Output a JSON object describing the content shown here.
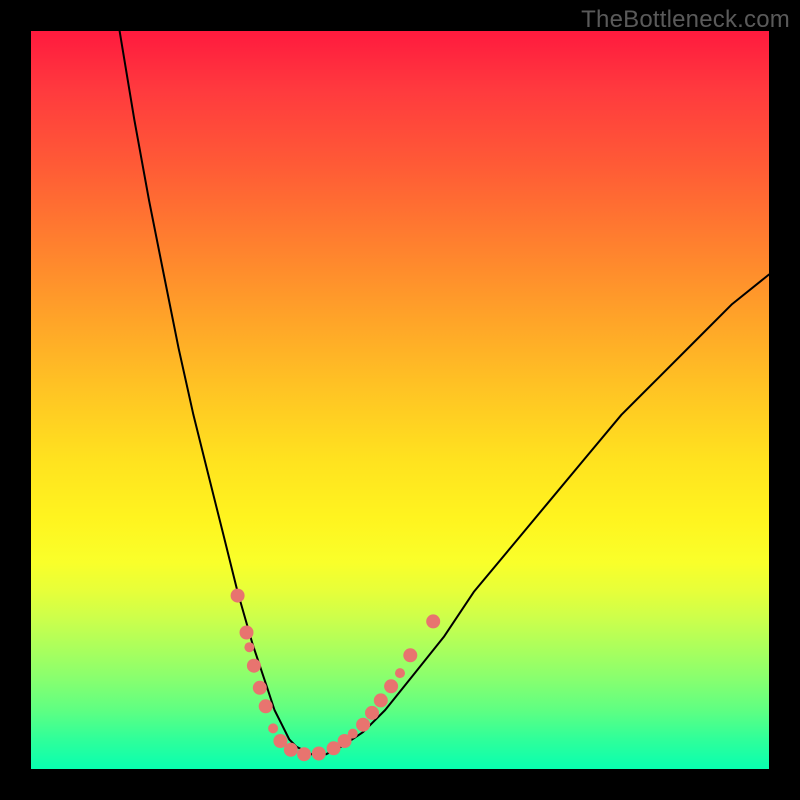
{
  "watermark": "TheBottleneck.com",
  "chart_data": {
    "type": "line",
    "title": "",
    "xlabel": "",
    "ylabel": "",
    "xlim": [
      0,
      100
    ],
    "ylim": [
      0,
      100
    ],
    "grid": false,
    "legend": false,
    "series": [
      {
        "name": "curve",
        "x": [
          12,
          14,
          16,
          18,
          20,
          22,
          24,
          26,
          28,
          30,
          32,
          33,
          34,
          35,
          36,
          38,
          40,
          42,
          45,
          48,
          52,
          56,
          60,
          65,
          70,
          75,
          80,
          85,
          90,
          95,
          100
        ],
        "y": [
          100,
          88,
          77,
          67,
          57,
          48,
          40,
          32,
          24,
          17,
          11,
          8,
          6,
          4,
          3,
          2,
          2,
          3,
          5,
          8,
          13,
          18,
          24,
          30,
          36,
          42,
          48,
          53,
          58,
          63,
          67
        ],
        "stroke": "#000000",
        "stroke_width": 2
      }
    ],
    "markers": [
      {
        "x": 28.0,
        "y": 23.5,
        "r": 7
      },
      {
        "x": 29.2,
        "y": 18.5,
        "r": 7
      },
      {
        "x": 29.6,
        "y": 16.5,
        "r": 5
      },
      {
        "x": 30.2,
        "y": 14.0,
        "r": 7
      },
      {
        "x": 31.0,
        "y": 11.0,
        "r": 7
      },
      {
        "x": 31.8,
        "y": 8.5,
        "r": 7
      },
      {
        "x": 32.8,
        "y": 5.5,
        "r": 5
      },
      {
        "x": 33.8,
        "y": 3.8,
        "r": 7
      },
      {
        "x": 35.2,
        "y": 2.6,
        "r": 7
      },
      {
        "x": 37.0,
        "y": 2.0,
        "r": 7
      },
      {
        "x": 39.0,
        "y": 2.1,
        "r": 7
      },
      {
        "x": 41.0,
        "y": 2.8,
        "r": 7
      },
      {
        "x": 42.5,
        "y": 3.8,
        "r": 7
      },
      {
        "x": 43.6,
        "y": 4.8,
        "r": 5
      },
      {
        "x": 45.0,
        "y": 6.0,
        "r": 7
      },
      {
        "x": 46.2,
        "y": 7.6,
        "r": 7
      },
      {
        "x": 47.4,
        "y": 9.3,
        "r": 7
      },
      {
        "x": 48.8,
        "y": 11.2,
        "r": 7
      },
      {
        "x": 50.0,
        "y": 13.0,
        "r": 5
      },
      {
        "x": 51.4,
        "y": 15.4,
        "r": 7
      },
      {
        "x": 54.5,
        "y": 20.0,
        "r": 7
      }
    ],
    "marker_style": {
      "fill": "#e8746f",
      "outline": "none"
    }
  }
}
